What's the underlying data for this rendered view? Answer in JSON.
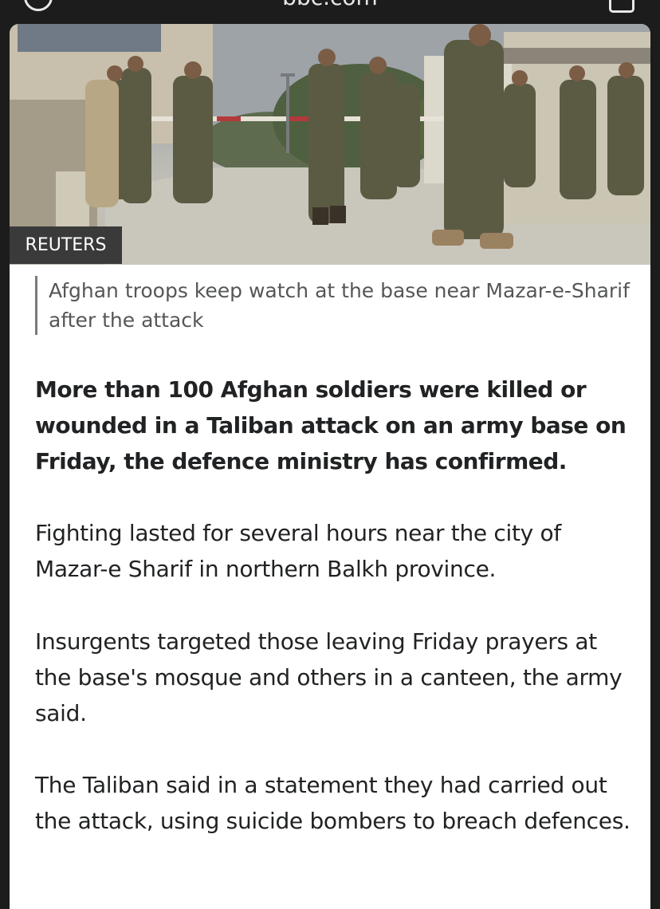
{
  "browser": {
    "url": "bbc.com"
  },
  "image": {
    "credit": "REUTERS",
    "caption": "Afghan troops keep watch at the base near Mazar-e-Sharif after the attack"
  },
  "article": {
    "lead": "More than 100 Afghan soldiers were killed or wounded in a Taliban attack on an army base on Friday, the defence ministry has confirmed.",
    "paragraphs": [
      "Fighting lasted for several hours near the city of Mazar-e Sharif in northern Balkh province.",
      "Insurgents targeted those leaving Friday prayers at the base's mosque and others in a canteen, the army said.",
      "The Taliban said in a statement they had carried out the attack, using suicide bombers to breach defences."
    ]
  },
  "icons": {
    "info": "info-icon",
    "tabs": "tabs-icon"
  }
}
